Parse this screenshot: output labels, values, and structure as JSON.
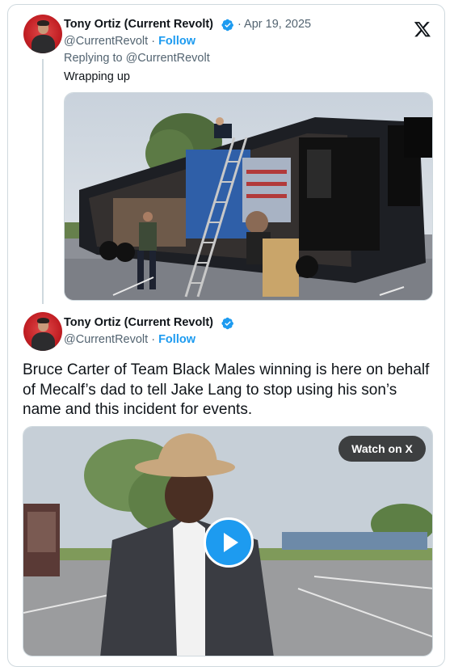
{
  "tweet1": {
    "author": "Tony Ortiz (Current Revolt)",
    "date": "· Apr 19, 2025",
    "handle": "@CurrentRevolt",
    "separator": "·",
    "follow": "Follow",
    "replying_to": "Replying to @CurrentRevolt",
    "text": "Wrapping up"
  },
  "tweet2": {
    "author": "Tony Ortiz (Current Revolt)",
    "handle": "@CurrentRevolt",
    "separator": "·",
    "follow": "Follow",
    "text": "Bruce Carter of Team Black Males winning is here on behalf of Mecalf’s dad to tell Jake Lang to stop using his son’s name and this incident for events.",
    "watch_label": "Watch on X"
  },
  "colors": {
    "accent": "#1d9bf0",
    "secondary_text": "#536471",
    "border": "#cfd9de"
  },
  "icons": [
    "verified-badge-icon",
    "x-logo-icon",
    "play-icon"
  ]
}
